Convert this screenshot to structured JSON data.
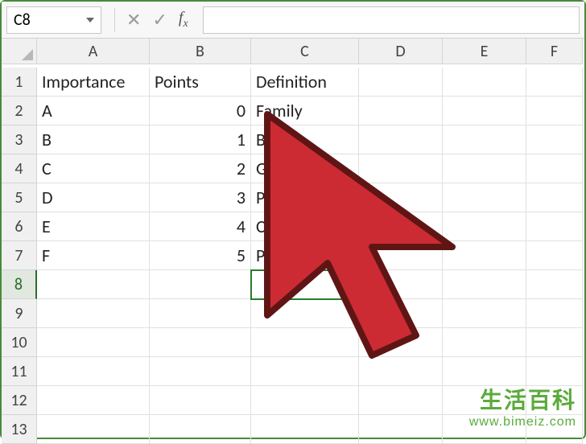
{
  "nameBox": {
    "value": "C8"
  },
  "formulaBar": {
    "value": ""
  },
  "columns": [
    "A",
    "B",
    "C",
    "D",
    "E",
    "F"
  ],
  "rows": [
    "1",
    "2",
    "3",
    "4",
    "5",
    "6",
    "7",
    "8",
    "9",
    "10",
    "11",
    "12",
    "13"
  ],
  "activeRow": "8",
  "selectedCell": "C8",
  "table": {
    "headers": {
      "A": "Importance",
      "B": "Points",
      "C": "Definition"
    },
    "rows": [
      {
        "A": "A",
        "B": "0",
        "C": "Family"
      },
      {
        "A": "B",
        "B": "1",
        "C": "Bills"
      },
      {
        "A": "C",
        "B": "2",
        "C": "Girlfriend"
      },
      {
        "A": "D",
        "B": "3",
        "C": "PC"
      },
      {
        "A": "E",
        "B": "4",
        "C": "Car"
      },
      {
        "A": "F",
        "B": "5",
        "C": "Pets"
      }
    ]
  },
  "watermark": {
    "title": "生活百科",
    "url": "www.bimeiz.com"
  }
}
